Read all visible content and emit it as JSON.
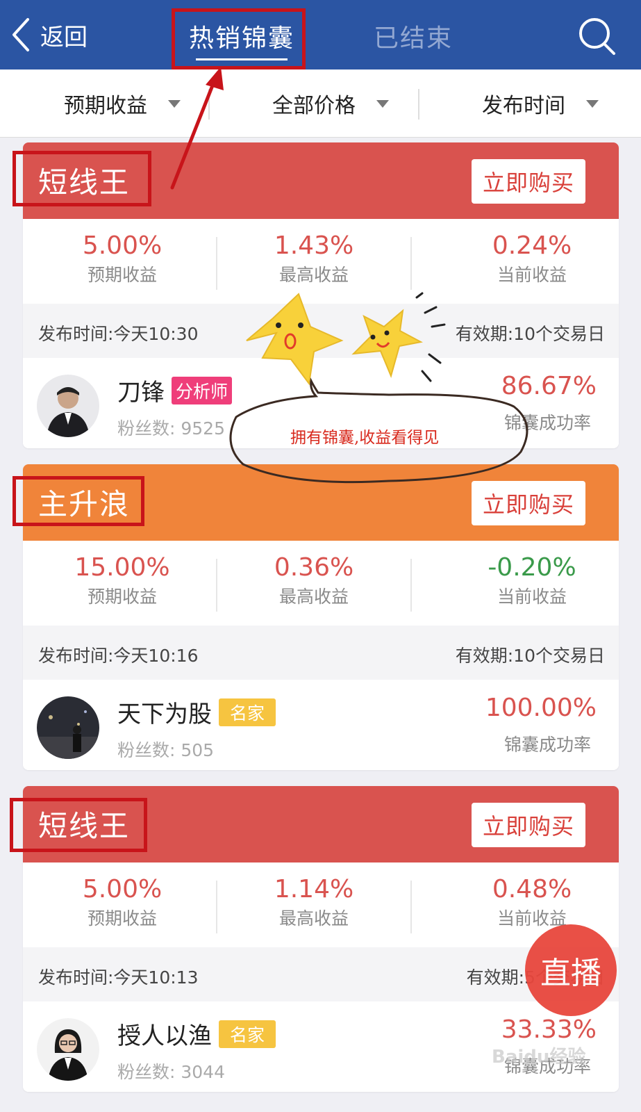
{
  "header": {
    "back_label": "返回",
    "tabs": [
      {
        "label": "热销锦囊",
        "active": true
      },
      {
        "label": "已结束",
        "active": false
      }
    ]
  },
  "filters": [
    {
      "label": "预期收益"
    },
    {
      "label": "全部价格"
    },
    {
      "label": "发布时间"
    }
  ],
  "cards": [
    {
      "title": "短线王",
      "head_color": "#d9534f",
      "buy_label": "立即购买",
      "stats": [
        {
          "value": "5.00%",
          "label": "预期收益"
        },
        {
          "value": "1.43%",
          "label": "最高收益"
        },
        {
          "value": "0.24%",
          "label": "当前收益"
        }
      ],
      "publish": "发布时间:今天10:30",
      "validity": "有效期:10个交易日",
      "author": {
        "name": "刀锋",
        "badge": "分析师",
        "fans": "粉丝数: 9525"
      },
      "success_rate": "86.67%",
      "success_label": "锦囊成功率"
    },
    {
      "title": "主升浪",
      "head_color": "#f0843a",
      "buy_label": "立即购买",
      "stats": [
        {
          "value": "15.00%",
          "label": "预期收益"
        },
        {
          "value": "0.36%",
          "label": "最高收益"
        },
        {
          "value": "-0.20%",
          "label": "当前收益"
        }
      ],
      "publish": "发布时间:今天10:16",
      "validity": "有效期:10个交易日",
      "author": {
        "name": "天下为股",
        "badge": "名家",
        "fans": "粉丝数: 505"
      },
      "success_rate": "100.00%",
      "success_label": "锦囊成功率"
    },
    {
      "title": "短线王",
      "head_color": "#d9534f",
      "buy_label": "立即购买",
      "stats": [
        {
          "value": "5.00%",
          "label": "预期收益"
        },
        {
          "value": "1.14%",
          "label": "最高收益"
        },
        {
          "value": "0.48%",
          "label": "当前收益"
        }
      ],
      "publish": "发布时间:今天10:13",
      "validity": "有效期:5个交易日",
      "author": {
        "name": "授人以渔",
        "badge": "名家",
        "fans": "粉丝数: 3044"
      },
      "success_rate": "33.33%",
      "success_label": "锦囊成功率"
    }
  ],
  "annotation": {
    "bubble_text": "拥有锦囊,收益看得见"
  },
  "live_button": {
    "label": "直播"
  },
  "watermark": "Baidu经验",
  "colors": {
    "header_bg": "#2b55a3",
    "accent_red": "#d9534f",
    "accent_orange": "#f0843a",
    "positive": "#d9534f",
    "negative": "#3a9a4a",
    "annotation_red": "#c8141a"
  }
}
